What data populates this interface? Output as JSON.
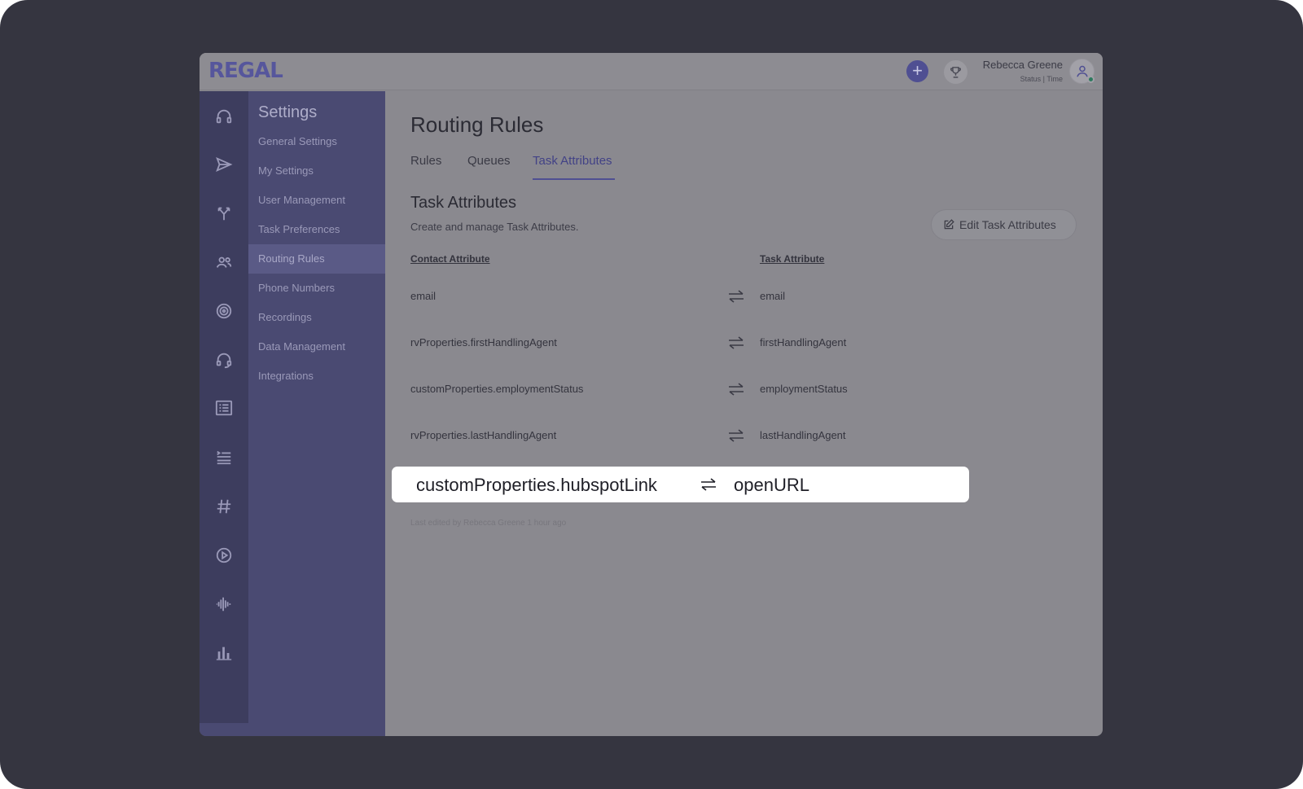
{
  "header": {
    "logo": "REGAL",
    "add_label": "+",
    "user_name": "Rebecca Greene",
    "user_status": "Status | Time"
  },
  "rail": {
    "icons": [
      "headset-icon",
      "send-icon",
      "branch-icon",
      "people-icon",
      "target-icon",
      "headset-outline-icon",
      "list-card-icon",
      "indent-list-icon",
      "hashtag-icon",
      "play-icon",
      "waveform-icon",
      "bar-chart-icon"
    ],
    "settings_icon": "gear-icon"
  },
  "settings": {
    "title": "Settings",
    "items": [
      {
        "label": "General Settings"
      },
      {
        "label": "My Settings"
      },
      {
        "label": "User Management"
      },
      {
        "label": "Task Preferences"
      },
      {
        "label": "Routing Rules",
        "active": true
      },
      {
        "label": "Phone Numbers"
      },
      {
        "label": "Recordings"
      },
      {
        "label": "Data Management"
      },
      {
        "label": "Integrations"
      }
    ]
  },
  "main": {
    "title": "Routing Rules",
    "tabs": [
      {
        "label": "Rules"
      },
      {
        "label": "Queues"
      },
      {
        "label": "Task Attributes",
        "active": true
      }
    ],
    "section_title": "Task Attributes",
    "section_desc": "Create and manage Task Attributes.",
    "edit_button": "Edit Task Attributes",
    "columns": {
      "contact": "Contact Attribute",
      "task": "Task Attribute"
    },
    "rows": [
      {
        "contact": "email",
        "task": "email"
      },
      {
        "contact": "rvProperties.firstHandlingAgent",
        "task": "firstHandlingAgent"
      },
      {
        "contact": "customProperties.employmentStatus",
        "task": "employmentStatus"
      },
      {
        "contact": "rvProperties.lastHandlingAgent",
        "task": "lastHandlingAgent"
      }
    ],
    "last_edited": "Last edited by Rebecca Greene 1 hour ago"
  },
  "highlight": {
    "contact": "customProperties.hubspotLink",
    "task": "openURL"
  },
  "colors": {
    "brand": "#4f4f92",
    "backdrop": "#353540",
    "highlight_bg": "#ffffff"
  }
}
